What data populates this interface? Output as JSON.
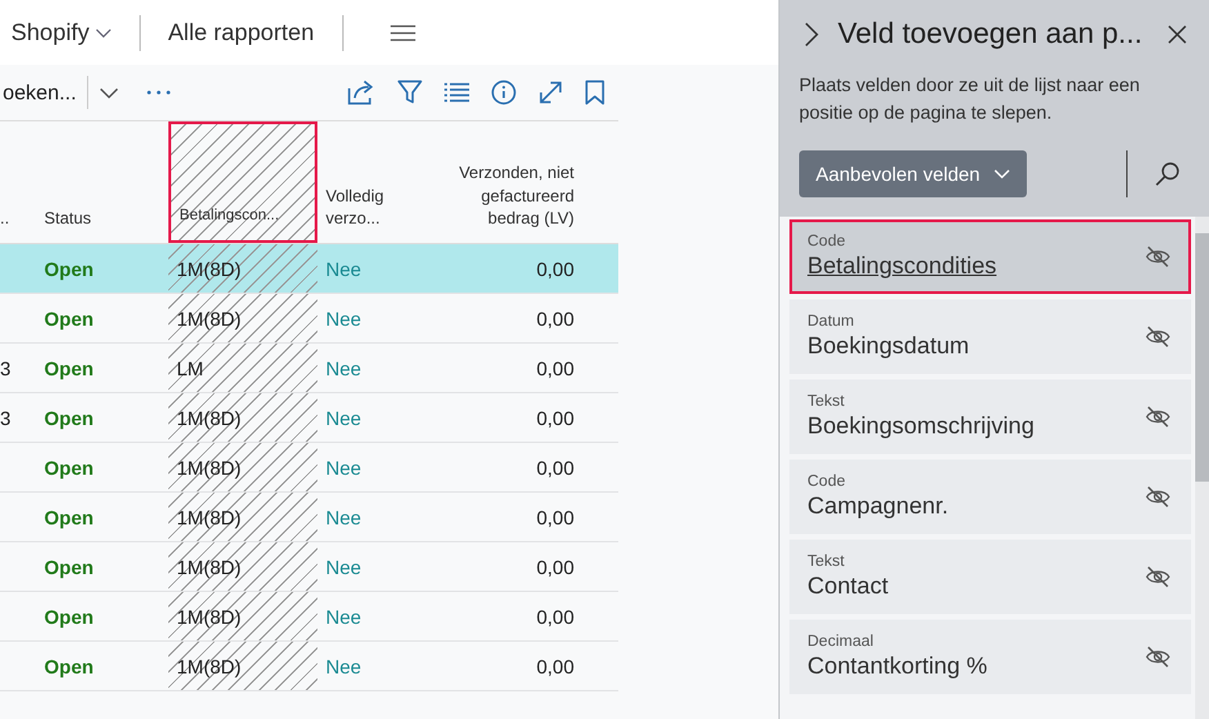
{
  "nav": {
    "items": [
      {
        "label": "Shopify",
        "kind": "dropdown"
      },
      {
        "label": "Alle rapporten",
        "kind": "link"
      }
    ]
  },
  "toolbar": {
    "action": "oeken..."
  },
  "table": {
    "columns": [
      {
        "label": "..",
        "kind": "text"
      },
      {
        "label": "Status",
        "kind": "text"
      },
      {
        "label": "Betalingscon...",
        "kind": "placeholder",
        "selected": true
      },
      {
        "label": "Volledig verzo...",
        "kind": "text"
      },
      {
        "label": "Verzonden, niet gefactureerd bedrag (LV)",
        "kind": "amount"
      }
    ],
    "rows": [
      {
        "selected": true,
        "cells": [
          "",
          "Open",
          "1M(8D)",
          "Nee",
          "0,00"
        ]
      },
      {
        "selected": false,
        "cells": [
          "",
          "Open",
          "1M(8D)",
          "Nee",
          "0,00"
        ]
      },
      {
        "selected": false,
        "cells": [
          "3",
          "Open",
          "LM",
          "Nee",
          "0,00"
        ]
      },
      {
        "selected": false,
        "cells": [
          "3",
          "Open",
          "1M(8D)",
          "Nee",
          "0,00"
        ]
      },
      {
        "selected": false,
        "cells": [
          "",
          "Open",
          "1M(8D)",
          "Nee",
          "0,00"
        ]
      },
      {
        "selected": false,
        "cells": [
          "",
          "Open",
          "1M(8D)",
          "Nee",
          "0,00"
        ]
      },
      {
        "selected": false,
        "cells": [
          "",
          "Open",
          "1M(8D)",
          "Nee",
          "0,00"
        ]
      },
      {
        "selected": false,
        "cells": [
          "",
          "Open",
          "1M(8D)",
          "Nee",
          "0,00"
        ]
      },
      {
        "selected": false,
        "cells": [
          "",
          "Open",
          "1M(8D)",
          "Nee",
          "0,00"
        ]
      }
    ]
  },
  "panel": {
    "title": "Veld toevoegen aan p...",
    "description": "Plaats velden door ze uit de lijst naar een positie op de pagina te slepen.",
    "filter_button": "Aanbevolen velden",
    "fields": [
      {
        "type": "Code",
        "name": "Betalingscondities",
        "selected": true
      },
      {
        "type": "Datum",
        "name": "Boekingsdatum",
        "selected": false
      },
      {
        "type": "Tekst",
        "name": "Boekingsomschrijving",
        "selected": false
      },
      {
        "type": "Code",
        "name": "Campagnenr.",
        "selected": false
      },
      {
        "type": "Tekst",
        "name": "Contact",
        "selected": false
      },
      {
        "type": "Decimaal",
        "name": "Contantkorting %",
        "selected": false
      }
    ]
  }
}
